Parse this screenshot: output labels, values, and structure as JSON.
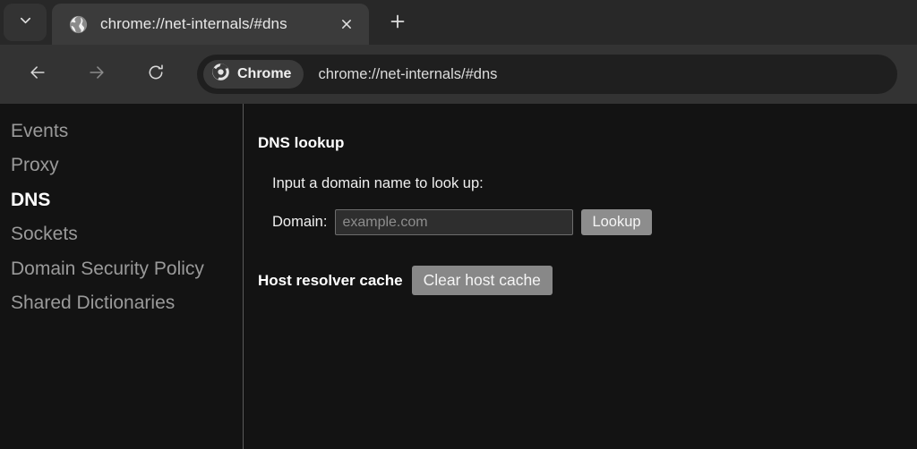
{
  "browser": {
    "tab_search_icon": "chevron-down-icon",
    "tab": {
      "favicon": "globe-icon",
      "title": "chrome://net-internals/#dns",
      "close_icon": "close-icon"
    },
    "new_tab_icon": "plus-icon",
    "toolbar": {
      "back_icon": "arrow-left-icon",
      "forward_icon": "arrow-right-icon",
      "reload_icon": "reload-icon",
      "chrome_chip_label": "Chrome",
      "chrome_chip_icon": "chrome-logo-icon",
      "url": "chrome://net-internals/#dns"
    }
  },
  "sidebar": {
    "items": [
      {
        "label": "Events",
        "selected": false
      },
      {
        "label": "Proxy",
        "selected": false
      },
      {
        "label": "DNS",
        "selected": true
      },
      {
        "label": "Sockets",
        "selected": false
      },
      {
        "label": "Domain Security Policy",
        "selected": false
      },
      {
        "label": "Shared Dictionaries",
        "selected": false
      }
    ]
  },
  "main": {
    "section_title": "DNS lookup",
    "lookup_hint": "Input a domain name to look up:",
    "domain_label": "Domain:",
    "domain_value": "",
    "domain_placeholder": "example.com",
    "lookup_button": "Lookup",
    "host_resolver_cache_label": "Host resolver cache",
    "clear_host_cache_button": "Clear host cache"
  },
  "colors": {
    "tab_strip_bg": "#282828",
    "active_tab_bg": "#3b3b3b",
    "toolbar_bg": "#333333",
    "omnibox_bg": "#1f1f1f",
    "page_bg": "#131313",
    "divider": "#5a5a5a",
    "button_gray": "#8d8d8d",
    "selected_text": "#ffffff",
    "muted_text": "#9a9a9a"
  }
}
